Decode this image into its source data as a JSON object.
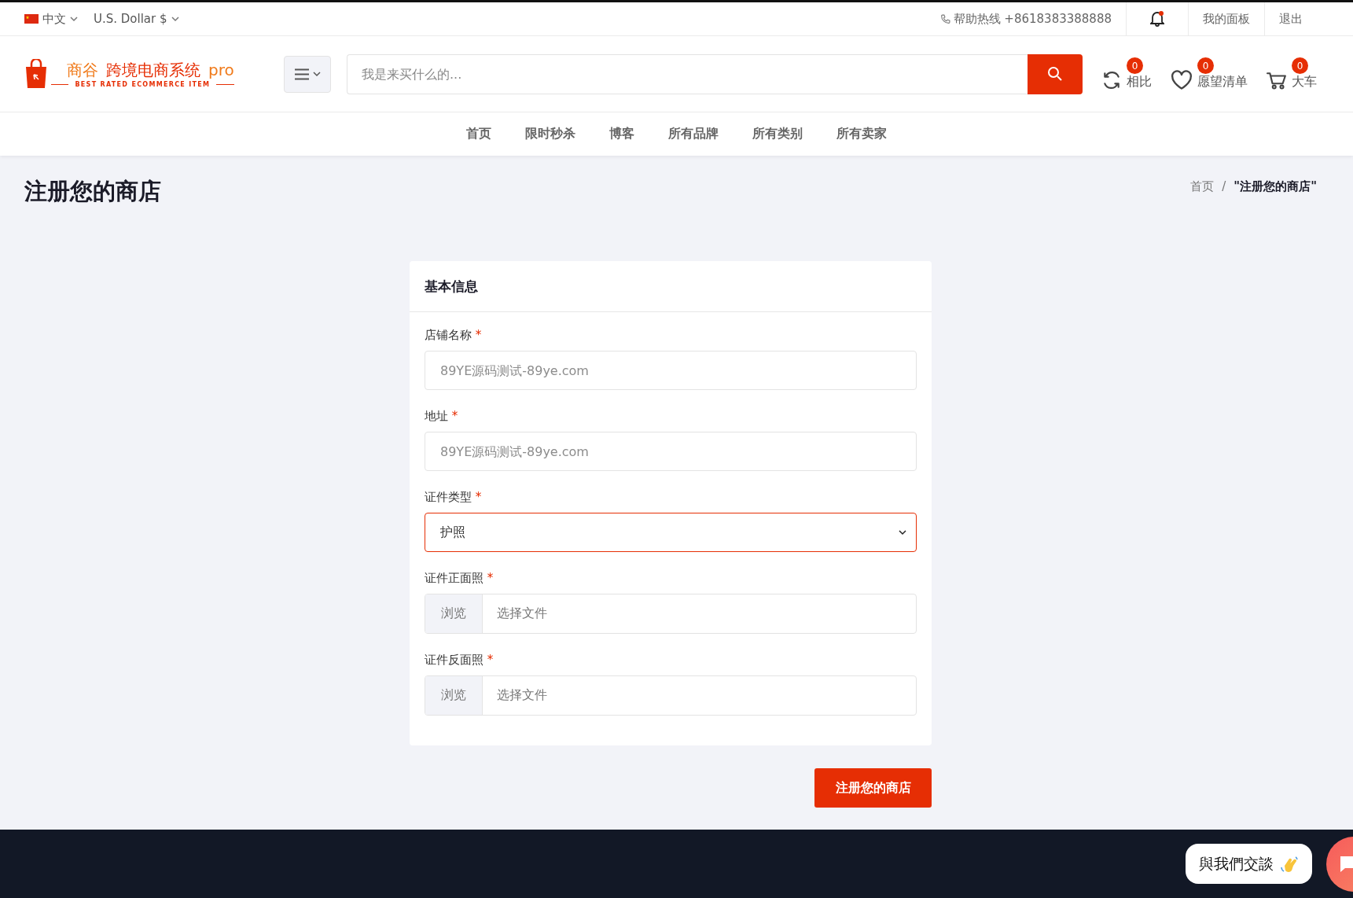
{
  "top_bar": {
    "language": "中文",
    "currency": "U.S. Dollar $",
    "hotline": "帮助热线 +8618383388888",
    "notification_dot": true,
    "links": [
      "我的面板",
      "退出"
    ]
  },
  "header": {
    "logo": {
      "part_1": "商谷",
      "part_2": "跨境电商系统",
      "part_3": "pro",
      "tagline": "BEST RATED ECOMMERCE ITEM"
    },
    "search": {
      "placeholder": "我是来买什么的..."
    },
    "actions": [
      {
        "kind": "compare",
        "label": "相比",
        "count": "0"
      },
      {
        "kind": "wishlist",
        "label": "愿望清单",
        "count": "0"
      },
      {
        "kind": "cart",
        "label": "大车",
        "count": "0"
      }
    ]
  },
  "nav": [
    "首页",
    "限时秒杀",
    "博客",
    "所有品牌",
    "所有类别",
    "所有卖家"
  ],
  "page": {
    "title": "注册您的商店",
    "breadcrumb": [
      "首页",
      "\"注册您的商店\""
    ],
    "breadcrumb_separator": "/"
  },
  "form": {
    "title": "基本信息",
    "required_mark": "*",
    "fields": [
      {
        "kind": "text",
        "label": "店铺名称",
        "placeholder": "89YE源码测试-89ye.com"
      },
      {
        "kind": "text",
        "label": "地址",
        "placeholder": "89YE源码测试-89ye.com"
      },
      {
        "kind": "select",
        "label": "证件类型",
        "value": "护照",
        "focused": true
      },
      {
        "kind": "file",
        "label": "证件正面照",
        "button": "浏览",
        "placeholder": "选择文件"
      },
      {
        "kind": "file",
        "label": "证件反面照",
        "button": "浏览",
        "placeholder": "选择文件"
      }
    ],
    "submit": "注册您的商店"
  },
  "chat": {
    "label": "與我們交談"
  }
}
